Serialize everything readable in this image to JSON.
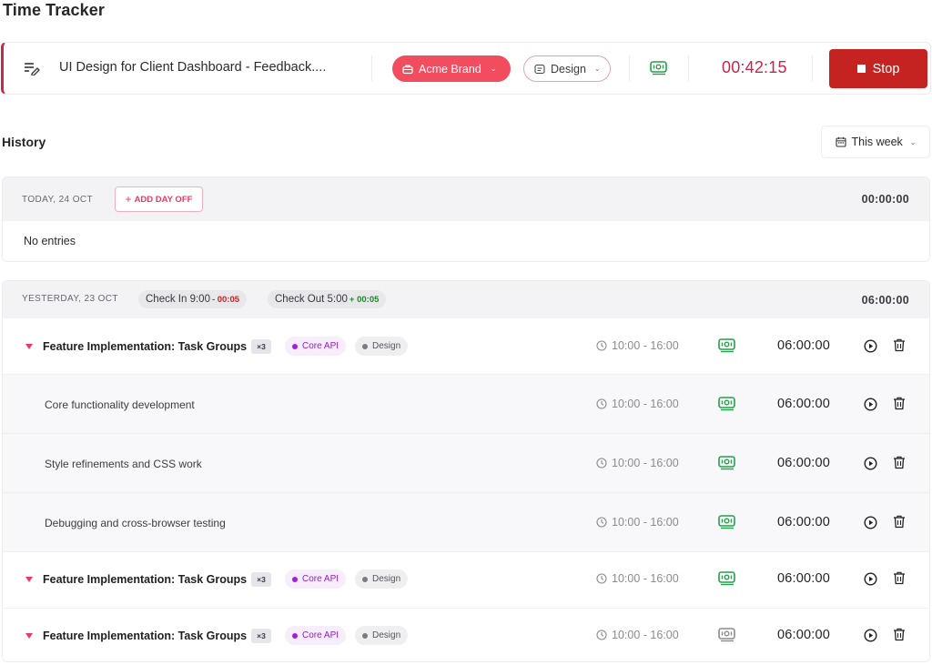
{
  "page": {
    "title": "Time Tracker"
  },
  "timer": {
    "description": "UI Design for Client Dashboard - Feedback....",
    "project": "Acme Brand",
    "tag": "Design",
    "elapsed": "00:42:15",
    "stop_label": "Stop",
    "colors": {
      "accent": "#c8264a",
      "project_chip": "#f24d5f",
      "stop": "#c42321",
      "billable": "#22a04b"
    }
  },
  "history": {
    "title": "History",
    "range": "This week",
    "days": [
      {
        "label": "TODAY, 24 OCT",
        "add_day_off": "ADD DAY OFF",
        "total": "00:00:00",
        "empty_text": "No entries"
      },
      {
        "label": "YESTERDAY, 23 OCT",
        "check_in": {
          "label": "Check In 9:00",
          "delta": "- 00:05"
        },
        "check_out": {
          "label": "Check Out 5:00",
          "delta": "+ 00:05"
        },
        "total": "06:00:00",
        "groups": [
          {
            "name": "Feature Implementation: Task Groups",
            "count": "×3",
            "project": "Core API",
            "tag": "Design",
            "time_range": "10:00 - 16:00",
            "billable": true,
            "duration": "06:00:00",
            "entries": [
              {
                "name": "Core functionality development",
                "time_range": "10:00 - 16:00",
                "billable": true,
                "duration": "06:00:00"
              },
              {
                "name": "Style refinements and CSS work",
                "time_range": "10:00 - 16:00",
                "billable": true,
                "duration": "06:00:00"
              },
              {
                "name": "Debugging and cross-browser testing",
                "time_range": "10:00 - 16:00",
                "billable": true,
                "duration": "06:00:00"
              }
            ]
          },
          {
            "name": "Feature Implementation: Task Groups",
            "count": "×3",
            "project": "Core API",
            "tag": "Design",
            "time_range": "10:00 - 16:00",
            "billable": true,
            "duration": "06:00:00"
          },
          {
            "name": "Feature Implementation: Task Groups",
            "count": "×3",
            "project": "Core API",
            "tag": "Design",
            "time_range": "10:00 - 16:00",
            "billable": false,
            "duration": "06:00:00"
          }
        ]
      }
    ]
  },
  "icons": {
    "description": "notes-edit-icon",
    "project": "briefcase-icon",
    "tag": "tag-card-icon",
    "billable": "money-icon",
    "stop": "stop-square-icon",
    "range": "calendar-icon",
    "time": "clock-icon",
    "play": "play-circle-icon",
    "delete": "trash-icon",
    "expand": "caret-down-icon"
  }
}
